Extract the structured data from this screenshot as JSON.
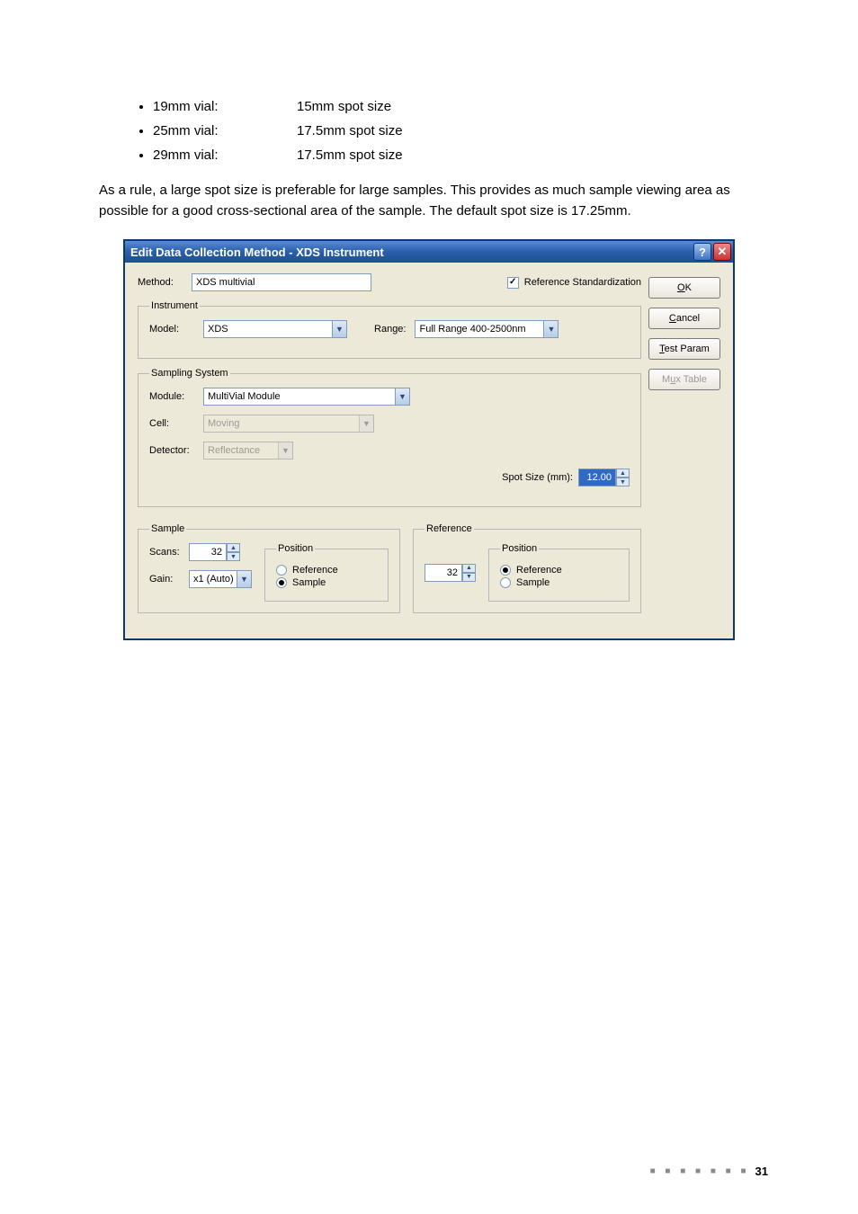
{
  "vial_rows": [
    {
      "label": "19mm vial:",
      "spot": "15mm spot size"
    },
    {
      "label": "25mm vial:",
      "spot": "17.5mm spot size"
    },
    {
      "label": "29mm vial:",
      "spot": "17.5mm spot size"
    }
  ],
  "body_text": "As a rule, a large spot size is preferable for large samples. This provides as much sample viewing area as possible for a good cross-sectional area of the sample. The default spot size is 17.25mm.",
  "dialog": {
    "title": "Edit Data Collection Method - XDS Instrument",
    "method": {
      "label": "Method:",
      "value": "XDS multivial"
    },
    "ref_std": {
      "checked": true,
      "label": "Reference Standardization"
    },
    "buttons": {
      "ok": "OK",
      "cancel": "Cancel",
      "test": "Test Param",
      "mux": "Mux Table"
    },
    "instrument": {
      "legend": "Instrument",
      "model_label": "Model:",
      "model_value": "XDS",
      "range_label": "Range:",
      "range_value": "Full Range 400-2500nm"
    },
    "sampling": {
      "legend": "Sampling System",
      "module_label": "Module:",
      "module_value": "MultiVial Module",
      "cell_label": "Cell:",
      "cell_value": "Moving",
      "detector_label": "Detector:",
      "detector_value": "Reflectance",
      "spot_label": "Spot Size (mm):",
      "spot_value": "12.00"
    },
    "sample": {
      "legend": "Sample",
      "scans_label": "Scans:",
      "scans_value": "32",
      "gain_label": "Gain:",
      "gain_value": "x1 (Auto)",
      "pos_legend": "Position",
      "pos_reference": "Reference",
      "pos_sample": "Sample"
    },
    "reference": {
      "legend": "Reference",
      "scans_value": "32",
      "pos_legend": "Position",
      "pos_reference": "Reference",
      "pos_sample": "Sample"
    }
  },
  "page_number": "31"
}
